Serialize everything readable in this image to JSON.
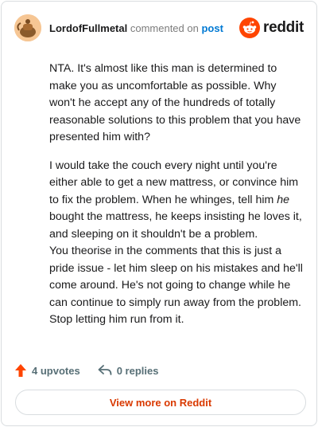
{
  "comment": {
    "username": "LordofFullmetal",
    "action_text": "commented on",
    "post_link": "post",
    "paragraphs": {
      "p1": "NTA. It's almost like this man is determined to make you as uncomfortable as possible. Why won't he accept any of the hundreds of totally reasonable solutions to this problem that you have presented him with?",
      "p2_before": "I would take the couch every night until you're either able to get a new mattress, or convince him to fix the problem. When he whinges, tell him ",
      "p2_em": "he",
      "p2_after": " bought the mattress, he keeps insisting he loves it, and sleeping on it shouldn't be a problem.",
      "p3": "You theorise in the comments that this is just a pride issue - let him sleep on his mistakes and he'll come around. He's not going to change while he can continue to simply run away from the problem. Stop letting him run from it."
    }
  },
  "brand": {
    "name": "reddit",
    "color": "#ff4500"
  },
  "actions": {
    "upvotes": "4 upvotes",
    "replies": "0 replies"
  },
  "footer": {
    "view_more": "View more on Reddit"
  },
  "colors": {
    "accent": "#d93900",
    "link": "#0079d3",
    "upvote": "#ff4500"
  }
}
